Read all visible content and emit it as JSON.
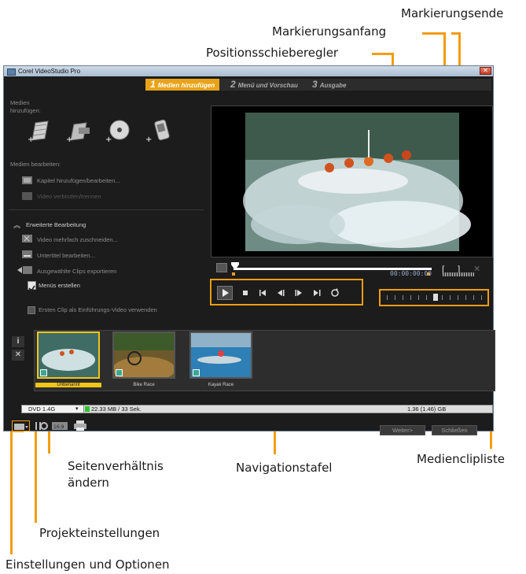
{
  "window": {
    "title": "Corel VideoStudio Pro",
    "close_glyph": "✕"
  },
  "tabs": [
    {
      "num": "1",
      "label": "Medien hinzufügen"
    },
    {
      "num": "2",
      "label": "Menü und Vorschau"
    },
    {
      "num": "3",
      "label": "Ausgabe"
    }
  ],
  "left_panel": {
    "add_media_label_1": "Medien",
    "add_media_label_2": "hinzufügen:",
    "edit_media_label": "Medien bearbeiten:",
    "chapter_item": "Kapitel hinzufügen/bearbeiten...",
    "join_item": "Video verbinden/trennen",
    "advanced_item": "Erweiterte Bearbeitung",
    "multitrim_item": "Video mehrfach zuschneiden...",
    "subtitle_item": "Untertitel bearbeiten...",
    "export_item": "Ausgewählte Clips exportieren",
    "create_menus_label": "Menüs erstellen",
    "intro_checkbox_label": "Ersten Clip als Einführungs-Video verwenden"
  },
  "player": {
    "timecode": "00:00:00:00"
  },
  "clips": [
    {
      "label": "Unbenannt",
      "selected": true
    },
    {
      "label": "Bike Race",
      "selected": false
    },
    {
      "label": "Kayak Race",
      "selected": false
    }
  ],
  "bottom": {
    "disc_type": "DVD 1.4G",
    "used_size": "22.33 MB / 33 Sek.",
    "capacity": "1.36 (1.46) GB",
    "next_button": "Weiter>",
    "close_button": "Schließen"
  },
  "callouts": {
    "mark_end": "Markierungsende",
    "mark_start": "Markierungsanfang",
    "position_slider": "Positionsschieberegler",
    "navigation_panel": "Navigationstafel",
    "media_clip_list": "Medienclipliste",
    "aspect_ratio_1": "Seitenverhältnis",
    "aspect_ratio_2": "ändern",
    "project_settings": "Projekteinstellungen",
    "settings_options": "Einstellungen und Optionen"
  },
  "colors": {
    "accent": "#f39c12",
    "tab_active": "#e8a319",
    "window_bg": "#1c1c1c"
  }
}
